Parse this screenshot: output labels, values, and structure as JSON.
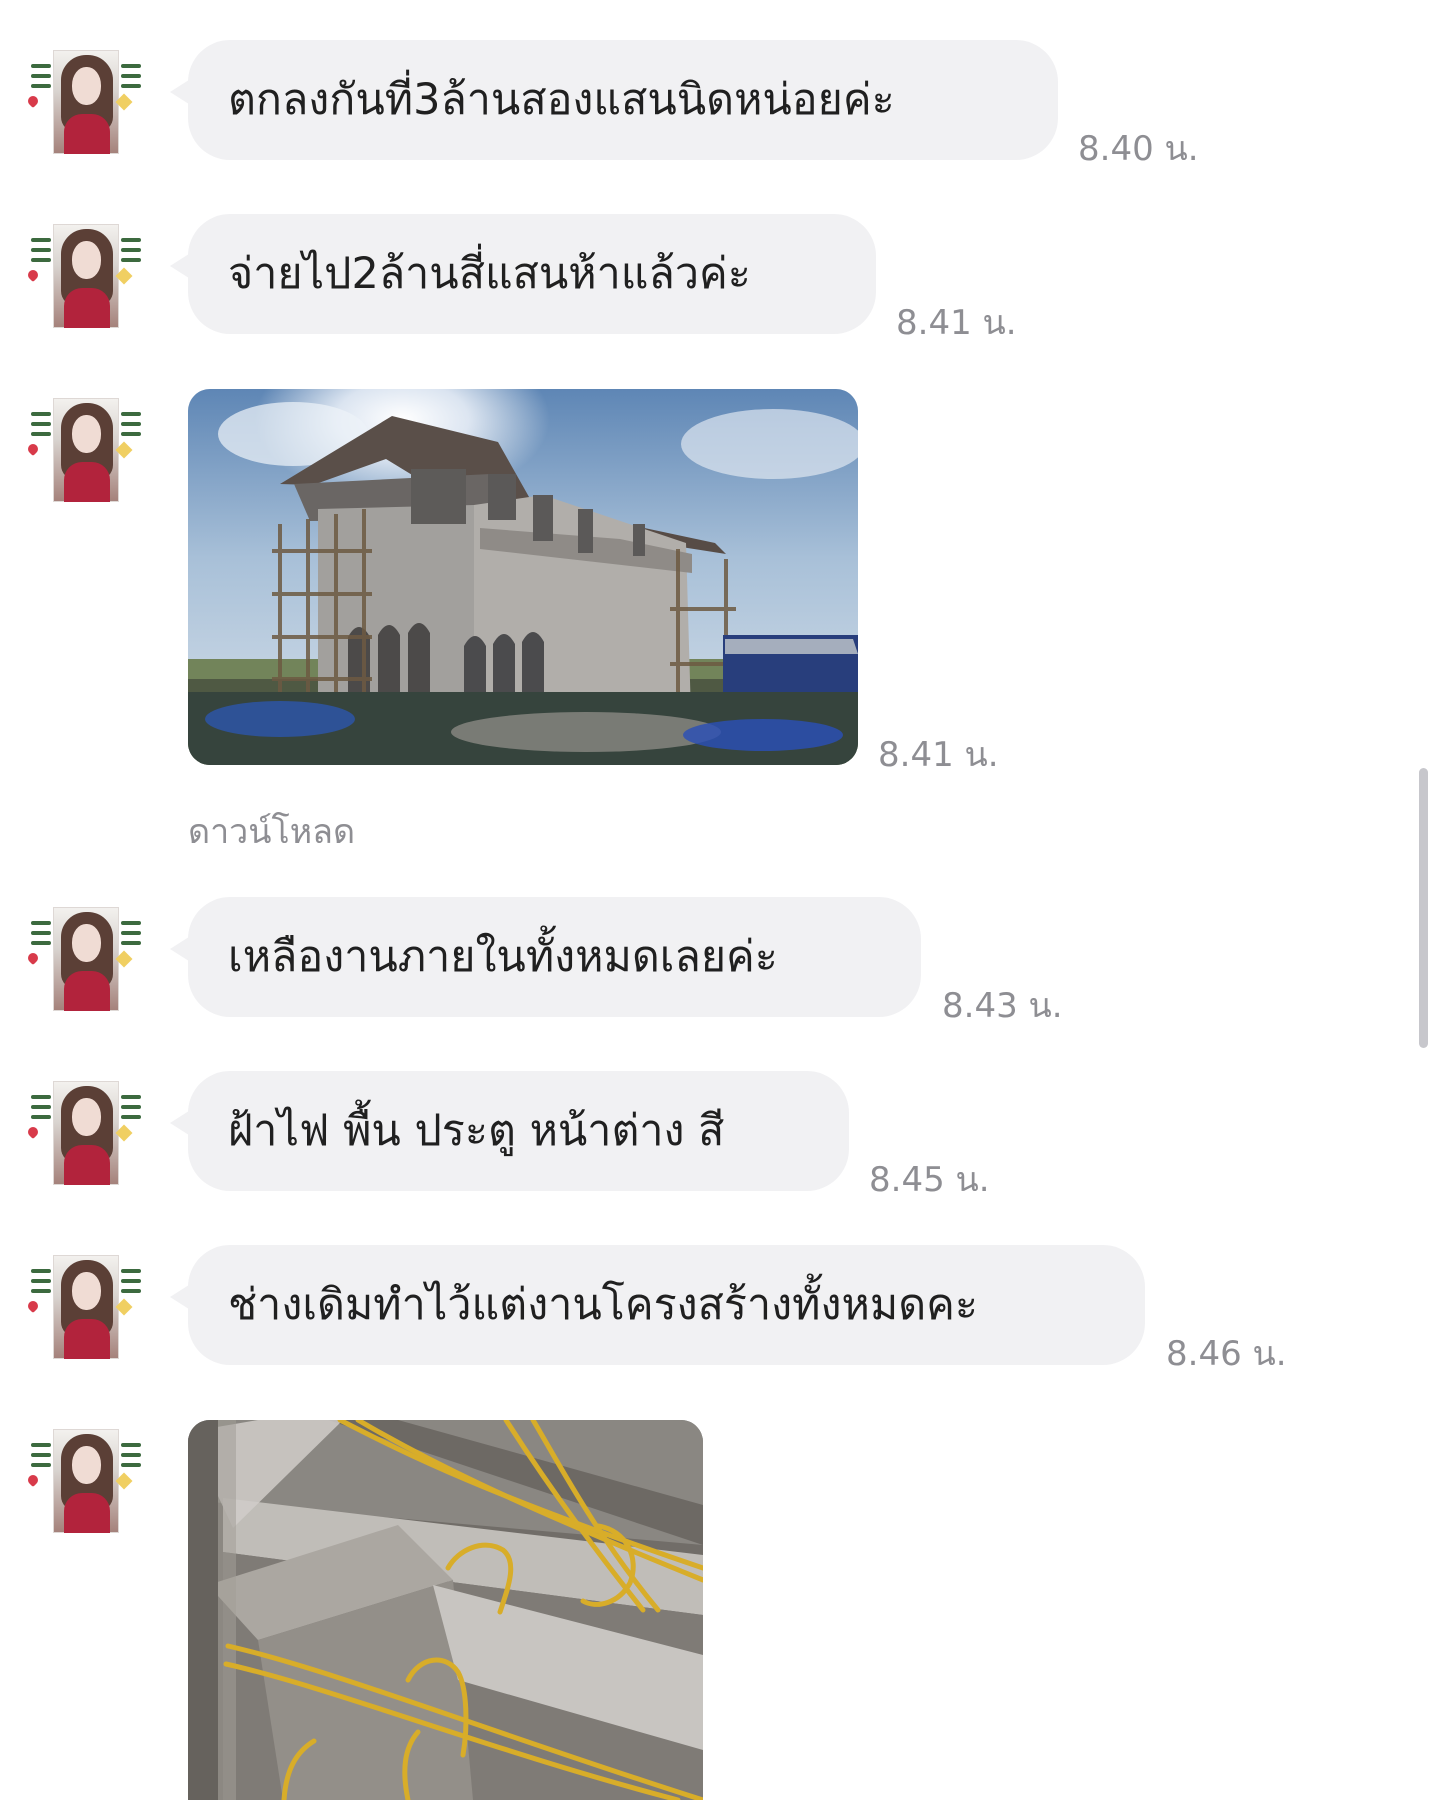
{
  "messages": [
    {
      "kind": "text",
      "text": "ตกลงกันที่3ล้านสองแสนนิดหน่อยค่ะ",
      "time": "8.40 น."
    },
    {
      "kind": "text",
      "text": "จ่ายไป2ล้านสี่แสนห้าแล้วค่ะ",
      "time": "8.41 น."
    },
    {
      "kind": "image",
      "image": "house-under-construction",
      "time": "8.41 น.",
      "caption": "ดาวน์โหลด"
    },
    {
      "kind": "text",
      "text": "เหลืองานภายในทั้งหมดเลยค่ะ",
      "time": "8.43 น."
    },
    {
      "kind": "text",
      "text": "ฝ้าไฟ พื้น ประตู หน้าต่าง สี",
      "time": "8.45 น."
    },
    {
      "kind": "text",
      "text": "ช่างเดิมทำไว้แต่งานโครงสร้างทั้งหมดคะ",
      "time": "8.46 น."
    },
    {
      "kind": "image",
      "image": "ceiling-electrical-conduits",
      "time": ""
    }
  ],
  "colors": {
    "bubble": "#f1f1f3",
    "text": "#202020",
    "meta": "#8e8e93",
    "scrollbar": "#c7c7cc"
  },
  "icons": {
    "avatar": "profile-photo-woman-with-thai-sticker-text"
  }
}
